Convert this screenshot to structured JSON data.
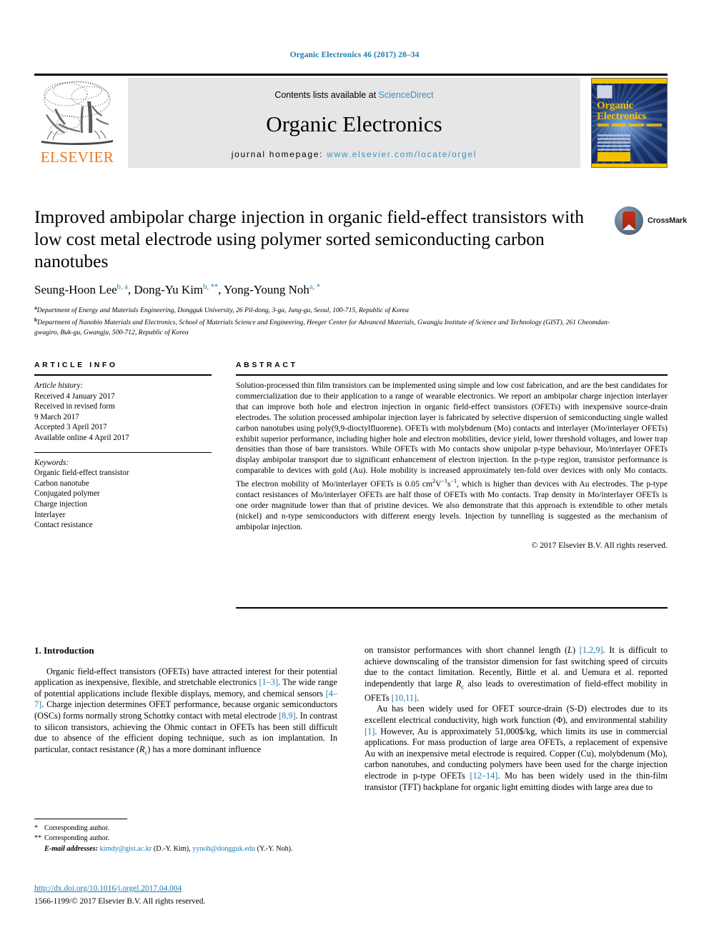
{
  "running_head": "Organic Electronics 46 (2017) 28–34",
  "masthead": {
    "contents_prefix": "Contents lists available at ",
    "sciencedirect": "ScienceDirect",
    "journal_title": "Organic Electronics",
    "homepage_prefix": "journal homepage: ",
    "homepage_url": "www.elsevier.com/locate/orgel",
    "publisher_wordmark": "ELSEVIER",
    "cover_title_line1": "Organic",
    "cover_title_line2": "Electronics"
  },
  "article": {
    "title": "Improved ambipolar charge injection in organic field-effect transistors with low cost metal electrode using polymer sorted semiconducting carbon nanotubes",
    "crossmark_label": "CrossMark",
    "authors": [
      {
        "name": "Seung-Hoon Lee",
        "marks": "b, a",
        "sep": ", "
      },
      {
        "name": "Dong-Yu Kim",
        "marks": "b, **",
        "sep": ", "
      },
      {
        "name": "Yong-Young Noh",
        "marks": "a, *",
        "sep": ""
      }
    ],
    "affiliations": [
      {
        "mark": "a",
        "text": "Department of Energy and Materials Engineering, Dongguk University, 26 Pil-dong, 3-ga, Jung-gu, Seoul, 100-715, Republic of Korea"
      },
      {
        "mark": "b",
        "text": "Department of Nanobio Materials and Electronics, School of Materials Science and Engineering, Heeger Center for Advanced Materials, Gwangju Institute of Science and Technology (GIST), 261 Cheomdan-gwagiro, Buk-gu, Gwangju, 500-712, Republic of Korea"
      }
    ]
  },
  "article_info": {
    "heading": "ARTICLE INFO",
    "history_label": "Article history:",
    "history": [
      "Received 4 January 2017",
      "Received in revised form",
      "9 March 2017",
      "Accepted 3 April 2017",
      "Available online 4 April 2017"
    ],
    "keywords_label": "Keywords:",
    "keywords": [
      "Organic field-effect transistor",
      "Carbon nanotube",
      "Conjugated polymer",
      "Charge injection",
      "Interlayer",
      "Contact resistance"
    ]
  },
  "abstract": {
    "heading": "ABSTRACT",
    "part1": "Solution-processed thin film transistors can be implemented using simple and low cost fabrication, and are the best candidates for commercialization due to their application to a range of wearable electronics. We report an ambipolar charge injection interlayer that can improve both hole and electron injection in organic field-effect transistors (OFETs) with inexpensive source-drain electrodes. The solution processed ambipolar injection layer is fabricated by selective dispersion of semiconducting single walled carbon nanotubes using poly(9,9-dioctylfluorene). OFETs with molybdenum (Mo) contacts and interlayer (Mo/interlayer OFETs) exhibit superior performance, including higher hole and electron mobilities, device yield, lower threshold voltages, and lower trap densities than those of bare transistors. While OFETs with Mo contacts show unipolar p-type behaviour, Mo/interlayer OFETs display ambipolar transport due to significant enhancement of electron injection. In the p-type region, transistor performance is comparable to devices with gold (Au). Hole mobility is increased approximately ten-fold over devices with only Mo contacts. The electron mobility of Mo/interlayer OFETs is 0.05 cm",
    "unit_sup1": "2",
    "unit_mid": "V",
    "unit_sup2": "−1",
    "unit_s": "s",
    "unit_sup3": "−1",
    "part2": ", which is higher than devices with Au electrodes. The p-type contact resistances of Mo/interlayer OFETs are half those of OFETs with Mo contacts. Trap density in Mo/interlayer OFETs is one order magnitude lower than that of pristine devices. We also demonstrate that this approach is extendible to other metals (nickel) and n-type semiconductors with different energy levels. Injection by tunnelling is suggested as the mechanism of ambipolar injection.",
    "copyright": "© 2017 Elsevier B.V. All rights reserved."
  },
  "introduction": {
    "heading": "1. Introduction",
    "left_p1_a": "Organic field-effect transistors (OFETs) have attracted interest for their potential application as inexpensive, flexible, and stretchable electronics ",
    "left_ref1": "[1–3]",
    "left_p1_b": ". The wide range of potential applications include flexible displays, memory, and chemical sensors ",
    "left_ref2": "[4–7]",
    "left_p1_c": ". Charge injection determines OFET performance, because organic semiconductors (OSCs) forms normally strong Schottky contact with metal electrode ",
    "left_ref3": "[8,9]",
    "left_p1_d": ". In contrast to silicon transistors, achieving the Ohmic contact in OFETs has been still difficult due to absence of the efficient doping technique, such as ion implantation. In particular, contact resistance (",
    "left_rc": "R",
    "left_rc_sub": "c",
    "left_p1_e": ") has a more dominant influence",
    "right_p1_a": "on transistor performances with short channel length (",
    "right_l_italic": "L",
    "right_p1_b": ") ",
    "right_ref1": "[1,2,9]",
    "right_p1_c": ". It is difficult to achieve downscaling of the transistor dimension for fast switching speed of circuits due to the contact limitation. Recently, Bittle et al. and Uemura et al. reported independently that large ",
    "right_rc": "R",
    "right_rc_sub": "c",
    "right_p1_d": " also leads to overestimation of field-effect mobility in OFETs ",
    "right_ref2": "[10,11]",
    "right_p1_e": ".",
    "right_p2_a": "Au has been widely used for OFET source-drain (S-D) electrodes due to its excellent electrical conductivity, high work function (Φ), and environmental stability ",
    "right_ref3": "[1]",
    "right_p2_b": ". However, Au is approximately 51,000$/kg, which limits its use in commercial applications. For mass production of large area OFETs, a replacement of expensive Au with an inexpensive metal electrode is required. Copper (Cu), molybdenum (Mo), carbon nanotubes, and conducting polymers have been used for the charge injection electrode in p-type OFETs ",
    "right_ref4": "[12–14]",
    "right_p2_c": ". Mo has been widely used in the thin-film transistor (TFT) backplane for organic light emitting diodes with large area due to"
  },
  "footnotes": {
    "corresponding_1_mark": "*",
    "corresponding_1": "Corresponding author.",
    "corresponding_2_mark": "**",
    "corresponding_2": "Corresponding author.",
    "email_label": "E-mail addresses:",
    "email_1": "kimdy@gist.ac.kr",
    "email_1_who": " (D.-Y. Kim), ",
    "email_2": "yynoh@dongguk.edu",
    "email_2_who": " (Y.-Y. Noh)."
  },
  "footer": {
    "doi": "http://dx.doi.org/10.1016/j.orgel.2017.04.004",
    "issn": "1566-1199/© 2017 Elsevier B.V. All rights reserved."
  },
  "colors": {
    "link_blue": "#1a7cb0",
    "sciencedirect_blue": "#3a8fc4",
    "elsevier_orange": "#e87722",
    "banner_gray": "#e6e6e6",
    "cover_yellow": "#f2c200",
    "crossmark_red": "#b02a13"
  }
}
